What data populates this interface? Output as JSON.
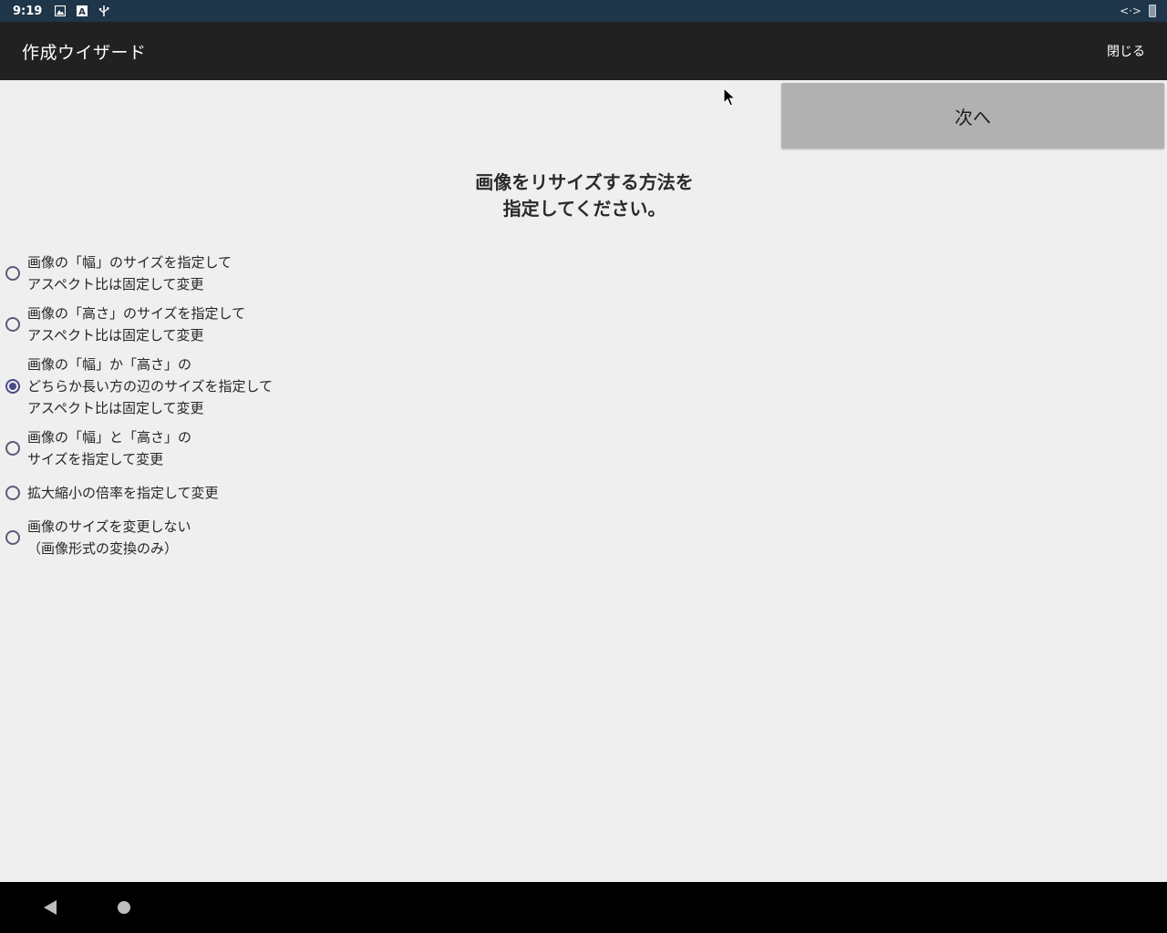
{
  "statusbar": {
    "time": "9:19",
    "icons": [
      "image-icon",
      "a-icon",
      "usb-icon"
    ],
    "right_icons": [
      "data-transfer-icon",
      "battery-icon"
    ],
    "data_arrows": "<·>"
  },
  "toolbar": {
    "title": "作成ウイザード",
    "close_label": "閉じる"
  },
  "content": {
    "next_label": "次へ",
    "heading": "画像をリサイズする方法を\n指定してください。",
    "options": [
      {
        "label": "画像の「幅」のサイズを指定して\nアスペクト比は固定して変更",
        "checked": false
      },
      {
        "label": "画像の「高さ」のサイズを指定して\nアスペクト比は固定して変更",
        "checked": false
      },
      {
        "label": "画像の「幅」か「高さ」の\nどちらか長い方の辺のサイズを指定して\nアスペクト比は固定して変更",
        "checked": true
      },
      {
        "label": "画像の「幅」と「高さ」の\nサイズを指定して変更",
        "checked": false
      },
      {
        "label": "拡大縮小の倍率を指定して変更",
        "checked": false
      },
      {
        "label": "画像のサイズを変更しない\n（画像形式の変換のみ）",
        "checked": false
      }
    ]
  },
  "navbar": {
    "buttons": [
      "back-icon",
      "home-icon"
    ]
  },
  "colors": {
    "statusbar_bg": "#1f3549",
    "toolbar_bg": "#212121",
    "content_bg": "#efefef",
    "button_bg": "#b1b1b1",
    "radio_accent": "#4a4a8a"
  }
}
